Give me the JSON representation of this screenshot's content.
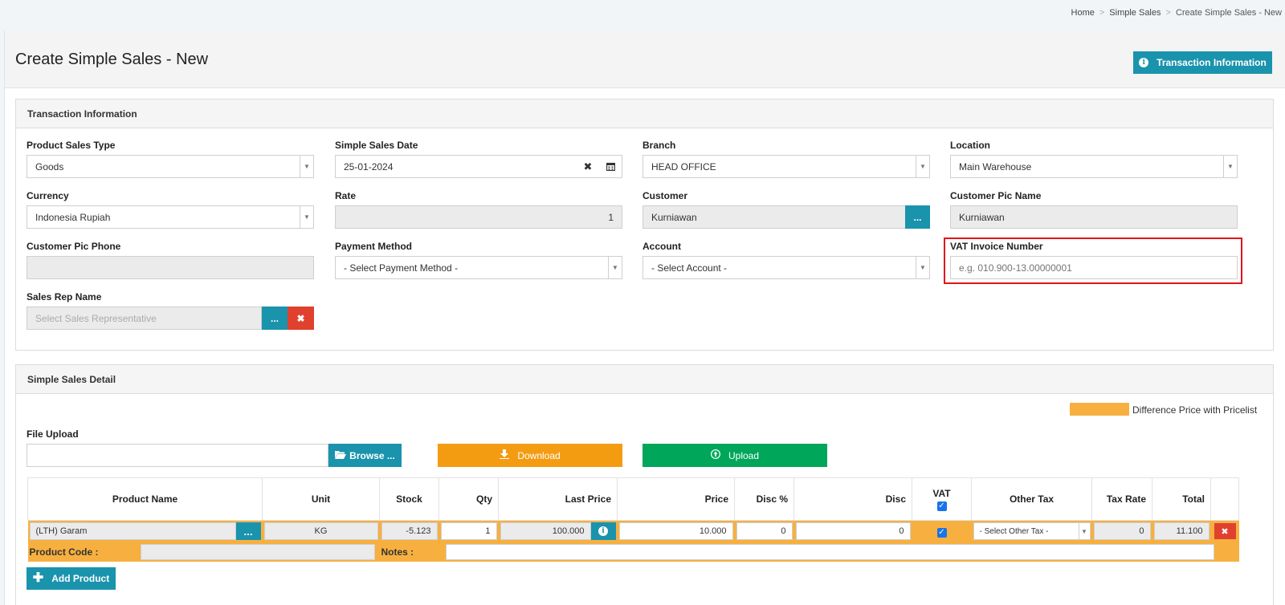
{
  "breadcrumb": {
    "home": "Home",
    "level1": "Simple Sales",
    "current": "Create Simple Sales - New"
  },
  "page": {
    "title": "Create Simple Sales - New",
    "info_button": "Transaction Information"
  },
  "transaction": {
    "heading": "Transaction Information",
    "product_sales_type": {
      "label": "Product Sales Type",
      "value": "Goods"
    },
    "sales_date": {
      "label": "Simple Sales Date",
      "value": "25-01-2024"
    },
    "branch": {
      "label": "Branch",
      "value": "HEAD OFFICE"
    },
    "location": {
      "label": "Location",
      "value": "Main Warehouse"
    },
    "currency": {
      "label": "Currency",
      "value": "Indonesia Rupiah"
    },
    "rate": {
      "label": "Rate",
      "value": "1"
    },
    "customer": {
      "label": "Customer",
      "value": "Kurniawan",
      "picker": "..."
    },
    "customer_pic_name": {
      "label": "Customer Pic Name",
      "value": "Kurniawan"
    },
    "customer_pic_phone": {
      "label": "Customer Pic Phone",
      "value": ""
    },
    "payment_method": {
      "label": "Payment Method",
      "value": "- Select Payment Method -"
    },
    "account": {
      "label": "Account",
      "value": "- Select Account -"
    },
    "vat_invoice": {
      "label": "VAT Invoice Number",
      "placeholder": "e.g. 010.900-13.00000001"
    },
    "sales_rep": {
      "label": "Sales Rep Name",
      "placeholder": "Select Sales Representative",
      "picker": "..."
    }
  },
  "detail": {
    "heading": "Simple Sales Detail",
    "legend": "Difference Price with Pricelist",
    "file_upload_label": "File Upload",
    "browse": "Browse ...",
    "download": "Download",
    "upload": "Upload",
    "columns": [
      "Product Name",
      "Unit",
      "Stock",
      "Qty",
      "Last Price",
      "Price",
      "Disc %",
      "Disc",
      "VAT",
      "Other Tax",
      "Tax Rate",
      "Total"
    ],
    "row": {
      "product_name": "(LTH) Garam",
      "picker": "...",
      "unit": "KG",
      "stock": "-5.123",
      "qty": "1",
      "last_price": "100.000",
      "price": "10.000",
      "disc_pct": "0",
      "disc": "0",
      "other_tax": "- Select Other Tax -",
      "tax_rate": "0",
      "total": "11.100",
      "product_code_label": "Product Code :",
      "notes_label": "Notes :"
    },
    "add_product": "Add Product"
  },
  "colors": {
    "teal": "#1a93ad",
    "red": "#e0412e",
    "orange": "#f39c12",
    "green": "#00a65a",
    "highlight": "#f7b040"
  }
}
